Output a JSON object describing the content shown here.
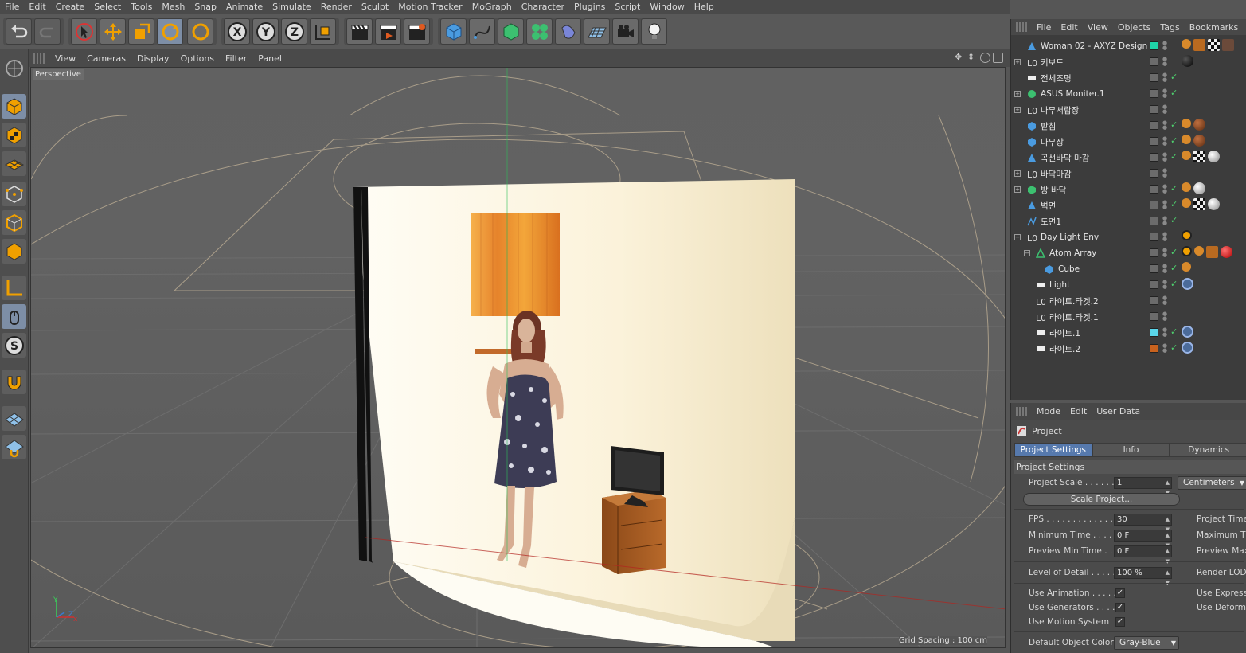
{
  "menubar": [
    "File",
    "Edit",
    "Create",
    "Select",
    "Tools",
    "Mesh",
    "Snap",
    "Animate",
    "Simulate",
    "Render",
    "Sculpt",
    "Motion Tracker",
    "MoGraph",
    "Character",
    "Plugins",
    "Script",
    "Window",
    "Help"
  ],
  "viewport": {
    "menu": [
      "View",
      "Cameras",
      "Display",
      "Options",
      "Filter",
      "Panel"
    ],
    "label": "Perspective",
    "grid_spacing": "Grid Spacing : 100 cm",
    "axis_y": "Y",
    "axis_x": "x",
    "axis_z": "Z"
  },
  "objects_panel": {
    "menu": [
      "File",
      "Edit",
      "View",
      "Objects",
      "Tags",
      "Bookmarks"
    ],
    "rows": [
      {
        "name": "Woman 02 - AXYZ Design",
        "swatch": "#1fd3a8"
      },
      {
        "name": "키보드"
      },
      {
        "name": "전체조명"
      },
      {
        "name": "ASUS Moniter.1"
      },
      {
        "name": "나무서랍장"
      },
      {
        "name": "받침"
      },
      {
        "name": "나무장"
      },
      {
        "name": "곡선바닥 마감"
      },
      {
        "name": "바닥마감"
      },
      {
        "name": "방 바닥"
      },
      {
        "name": "벽면"
      },
      {
        "name": "도면1"
      },
      {
        "name": "Day Light Env"
      },
      {
        "name": "Atom Array"
      },
      {
        "name": "Cube"
      },
      {
        "name": "Light"
      },
      {
        "name": "라이트.타겟.2"
      },
      {
        "name": "라이트.타겟.1"
      },
      {
        "name": "라이트.1",
        "swatch": "#5ad6ea"
      },
      {
        "name": "라이트.2",
        "swatch": "#c8621e"
      }
    ]
  },
  "attributes": {
    "menu": [
      "Mode",
      "Edit",
      "User Data"
    ],
    "header": "Project",
    "tabs": [
      "Project Settings",
      "Info",
      "Dynamics"
    ],
    "section": "Project Settings",
    "project_scale_label": "Project Scale . . . . . .",
    "project_scale_value": "1",
    "project_scale_unit": "Centimeters",
    "scale_button": "Scale Project...",
    "fps_label": "FPS . . . . . . . . . . . . . .",
    "fps_value": "30",
    "min_time_label": "Minimum Time . . . .",
    "min_time_value": "0 F",
    "prev_min_label": "Preview Min Time . .",
    "prev_min_value": "0 F",
    "project_time_label": "Project Time",
    "max_time_label": "Maximum Ti",
    "prev_max_label": "Preview Max",
    "lod_label": "Level of Detail . . . . .",
    "lod_value": "100 %",
    "render_lod_label": "Render LOD",
    "use_anim_label": "Use Animation . . . . .",
    "use_gen_label": "Use Generators . . . .",
    "use_motion_label": "Use Motion System",
    "use_expr_label": "Use Expressi",
    "use_deform_label": "Use Deforme",
    "check": "✓",
    "def_color_label": "Default Object Color",
    "def_color_value": "Gray-Blue"
  }
}
